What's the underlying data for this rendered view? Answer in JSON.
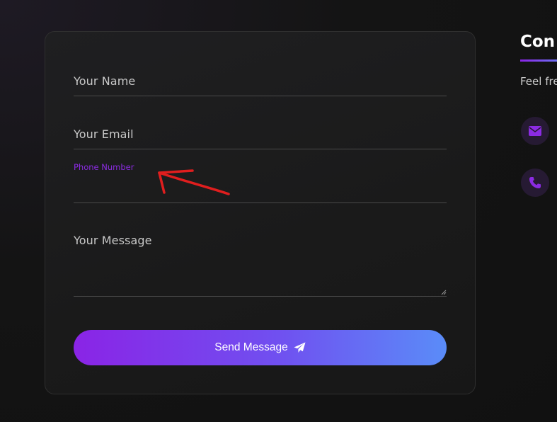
{
  "form": {
    "name_placeholder": "Your Name",
    "email_placeholder": "Your Email",
    "phone_label": "Phone Number",
    "message_placeholder": "Your Message",
    "send_label": "Send Message",
    "send_icon": "paper-plane-icon"
  },
  "sidebar": {
    "title": "Con",
    "description": "Feel fre",
    "contacts": [
      {
        "icon": "envelope-icon"
      },
      {
        "icon": "phone-icon"
      }
    ]
  },
  "colors": {
    "accent_purple": "#8b2be2",
    "gradient_start": "#8a24e6",
    "gradient_end": "#5a8cf8",
    "annotation_red": "#e01e1e",
    "background": "#141414",
    "card": "#1c1c1c"
  }
}
